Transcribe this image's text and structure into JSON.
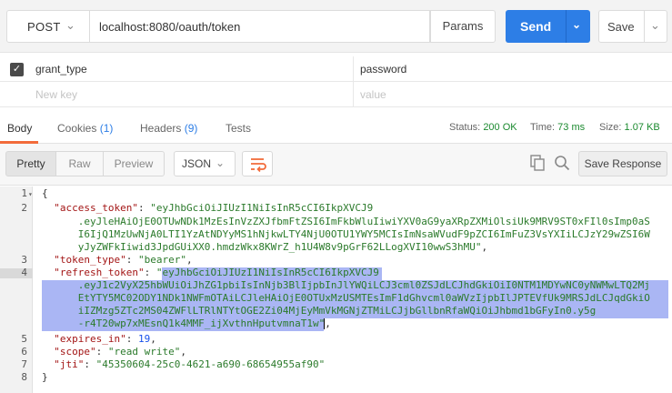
{
  "request": {
    "method": "POST",
    "url": "localhost:8080/oauth/token",
    "params_label": "Params",
    "send_label": "Send",
    "save_label": "Save"
  },
  "body_params": [
    {
      "checked": true,
      "key": "grant_type",
      "value": "password"
    }
  ],
  "new_row": {
    "key_placeholder": "New key",
    "value_placeholder": "value"
  },
  "response_tabs": [
    {
      "label": "Body",
      "count": "",
      "active": true
    },
    {
      "label": "Cookies",
      "count": "(1)",
      "active": false
    },
    {
      "label": "Headers",
      "count": "(9)",
      "active": false
    },
    {
      "label": "Tests",
      "count": "",
      "active": false
    }
  ],
  "status": {
    "status_label": "Status:",
    "status_value": "200 OK",
    "time_label": "Time:",
    "time_value": "73 ms",
    "size_label": "Size:",
    "size_value": "1.07 KB"
  },
  "view_modes": [
    "Pretty",
    "Raw",
    "Preview"
  ],
  "active_view": "Pretty",
  "format": "JSON",
  "save_response_label": "Save Response",
  "icons": {
    "wrap": "wrap-lines-icon",
    "copy": "copy-icon",
    "search": "search-icon",
    "method_dropdown": "chevron-down-icon",
    "checkbox": "checkmark-icon"
  },
  "colors": {
    "send_button": "#2d7ee6",
    "active_tab_underline": "#f26b3a",
    "status_ok": "#1b8a2f",
    "json_key": "#a31515",
    "json_string": "#2b7a2b",
    "json_number": "#1750eb",
    "selection": "#aab6f4"
  },
  "code_lines": [
    {
      "num": "1",
      "fold": true,
      "parts": [
        {
          "t": "{",
          "c": "p"
        }
      ]
    },
    {
      "num": "2",
      "parts": [
        {
          "t": "  ",
          "c": "p"
        },
        {
          "t": "\"access_token\"",
          "c": "k"
        },
        {
          "t": ": ",
          "c": "p"
        },
        {
          "t": "\"eyJhbGciOiJIUzI1NiIsInR5cCI6IkpXVCJ9",
          "c": "s"
        }
      ]
    },
    {
      "num": "",
      "parts": [
        {
          "t": "      .eyJleHAiOjE0OTUwNDk1MzEsInVzZXJfbmFtZSI6ImFkbWluIiwiYXV0aG9yaXRpZXMiOlsiUk9MRV9ST0xFIl0sImp0aS",
          "c": "s"
        }
      ]
    },
    {
      "num": "",
      "parts": [
        {
          "t": "      I6IjQ1MzUwNjA0LTI1YzAtNDYyMS1hNjkwLTY4NjU0OTU1YWY5MCIsImNsaWVudF9pZCI6ImFuZ3VsYXIiLCJzY29wZSI6W",
          "c": "s"
        }
      ]
    },
    {
      "num": "",
      "parts": [
        {
          "t": "      yJyZWFkIiwid3JpdGUiXX0.hmdzWkx8KWrZ_h1U4W8v9pGrF62LLogXVI10wwS3hMU\"",
          "c": "s"
        },
        {
          "t": ",",
          "c": "p"
        }
      ]
    },
    {
      "num": "3",
      "parts": [
        {
          "t": "  ",
          "c": "p"
        },
        {
          "t": "\"token_type\"",
          "c": "k"
        },
        {
          "t": ": ",
          "c": "p"
        },
        {
          "t": "\"bearer\"",
          "c": "s"
        },
        {
          "t": ",",
          "c": "p"
        }
      ]
    },
    {
      "num": "4",
      "sel": true,
      "parts": [
        {
          "t": "  ",
          "c": "p"
        },
        {
          "t": "\"refresh_token\"",
          "c": "k"
        },
        {
          "t": ": ",
          "c": "p"
        },
        {
          "t": "\"eyJhbGciOiJIUzI1NiIsInR5cCI6IkpXVCJ9",
          "c": "s"
        }
      ]
    },
    {
      "num": "",
      "parts": [
        {
          "t": "      .eyJ1c2VyX25hbWUiOiJhZG1pbiIsInNjb3BlIjpbInJlYWQiLCJ3cml0ZSJdLCJhdGkiOiI0NTM1MDYwNC0yNWMwLTQ2Mj",
          "c": "s"
        }
      ]
    },
    {
      "num": "",
      "parts": [
        {
          "t": "      EtYTY5MC02ODY1NDk1NWFmOTAiLCJleHAiOjE0OTUxMzUSMTEsImF1dGhvcml0aWVzIjpbIlJPTEVfUk9MRSJdLCJqdGkiO",
          "c": "s"
        }
      ]
    },
    {
      "num": "",
      "parts": [
        {
          "t": "      iIZMzg5ZTc2MS04ZWFlLTRlNTYtOGE2Zi04MjEyMmVkMGNjZTMiLCJjbGllbnRfaWQiOiJhbmd1bGFyIn0.y5g",
          "c": "s"
        }
      ]
    },
    {
      "num": "",
      "parts": [
        {
          "t": "      -r4T20wp7xMEsnQ1k4MMF_ijXvthnHputvmnaT1w\"",
          "c": "s"
        },
        {
          "t": ",",
          "c": "p"
        }
      ]
    },
    {
      "num": "5",
      "parts": [
        {
          "t": "  ",
          "c": "p"
        },
        {
          "t": "\"expires_in\"",
          "c": "k"
        },
        {
          "t": ": ",
          "c": "p"
        },
        {
          "t": "19",
          "c": "n"
        },
        {
          "t": ",",
          "c": "p"
        }
      ]
    },
    {
      "num": "6",
      "parts": [
        {
          "t": "  ",
          "c": "p"
        },
        {
          "t": "\"scope\"",
          "c": "k"
        },
        {
          "t": ": ",
          "c": "p"
        },
        {
          "t": "\"read write\"",
          "c": "s"
        },
        {
          "t": ",",
          "c": "p"
        }
      ]
    },
    {
      "num": "7",
      "parts": [
        {
          "t": "  ",
          "c": "p"
        },
        {
          "t": "\"jti\"",
          "c": "k"
        },
        {
          "t": ": ",
          "c": "p"
        },
        {
          "t": "\"45350604-25c0-4621-a690-68654955af90\"",
          "c": "s"
        }
      ]
    },
    {
      "num": "8",
      "parts": [
        {
          "t": "}",
          "c": "p"
        }
      ]
    }
  ]
}
